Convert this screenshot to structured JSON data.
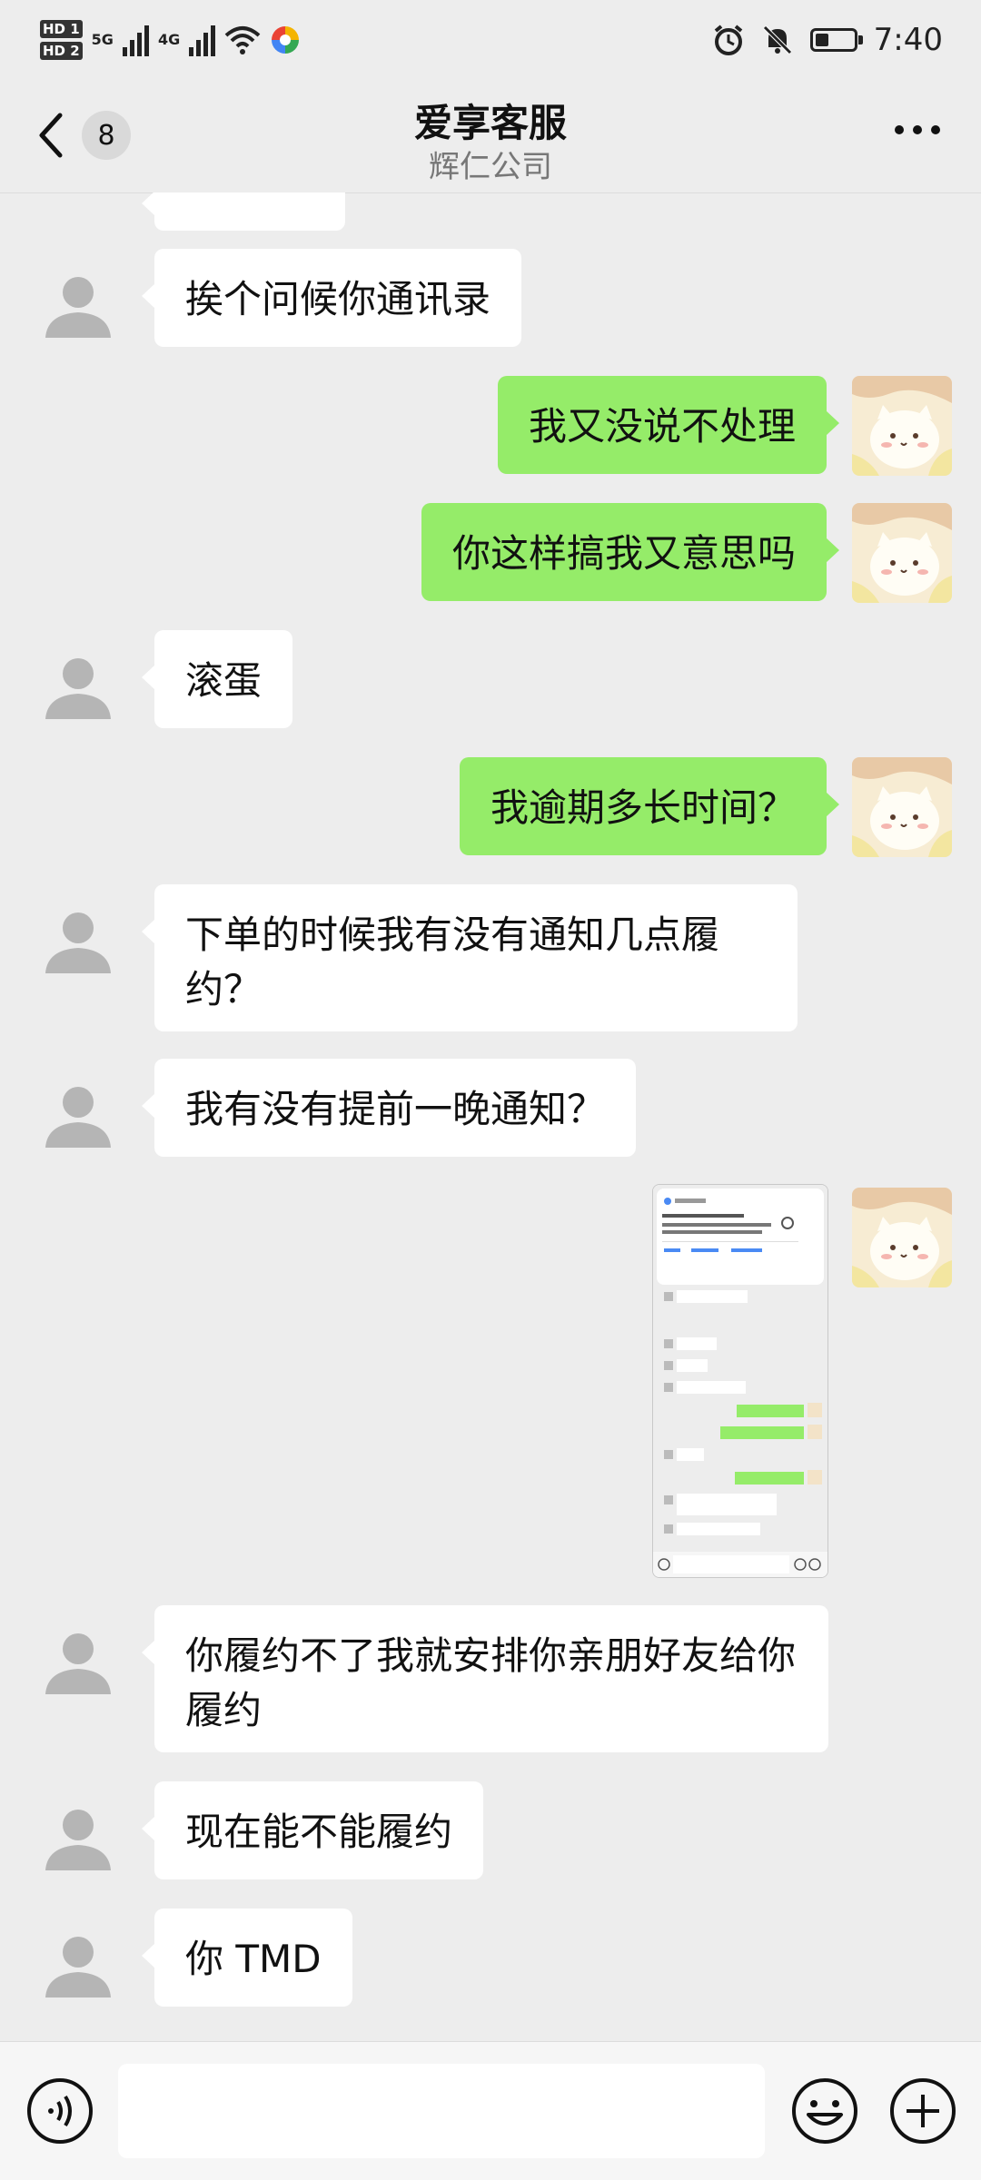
{
  "status_bar": {
    "hd_labels": [
      "HD 1",
      "HD 2"
    ],
    "network_1": "5G",
    "network_2": "4G",
    "time": "7:40",
    "battery_level": 0.35
  },
  "header": {
    "back_badge": "8",
    "title": "爱享客服",
    "subtitle": "辉仁公司"
  },
  "messages": [
    {
      "from": "other",
      "text": "挨个问候你通讯录"
    },
    {
      "from": "me",
      "text": "我又没说不处理"
    },
    {
      "from": "me",
      "text": "你这样搞我又意思吗"
    },
    {
      "from": "other",
      "text": "滚蛋"
    },
    {
      "from": "me",
      "text": "我逾期多长时间？"
    },
    {
      "from": "other",
      "text": "下单的时候我有没有通知几点履约？"
    },
    {
      "from": "other",
      "text": "我有没有提前一晚通知？"
    },
    {
      "from": "me",
      "type": "image",
      "text": ""
    },
    {
      "from": "other",
      "text": "你履约不了我就安排你亲朋好友给你履约"
    },
    {
      "from": "other",
      "text": "现在能不能履约"
    },
    {
      "from": "other",
      "text": "你 TMD"
    }
  ],
  "input": {
    "value": "",
    "placeholder": ""
  },
  "icons": {
    "back": "chevron-left-icon",
    "more": "more-dots-icon",
    "voice": "voice-icon",
    "emoji": "emoji-icon",
    "plus": "plus-icon",
    "alarm": "alarm-icon",
    "mute": "bell-off-icon",
    "wifi": "wifi-icon"
  },
  "colors": {
    "background": "#ededed",
    "my_bubble": "#95ec69",
    "their_bubble": "#ffffff"
  }
}
